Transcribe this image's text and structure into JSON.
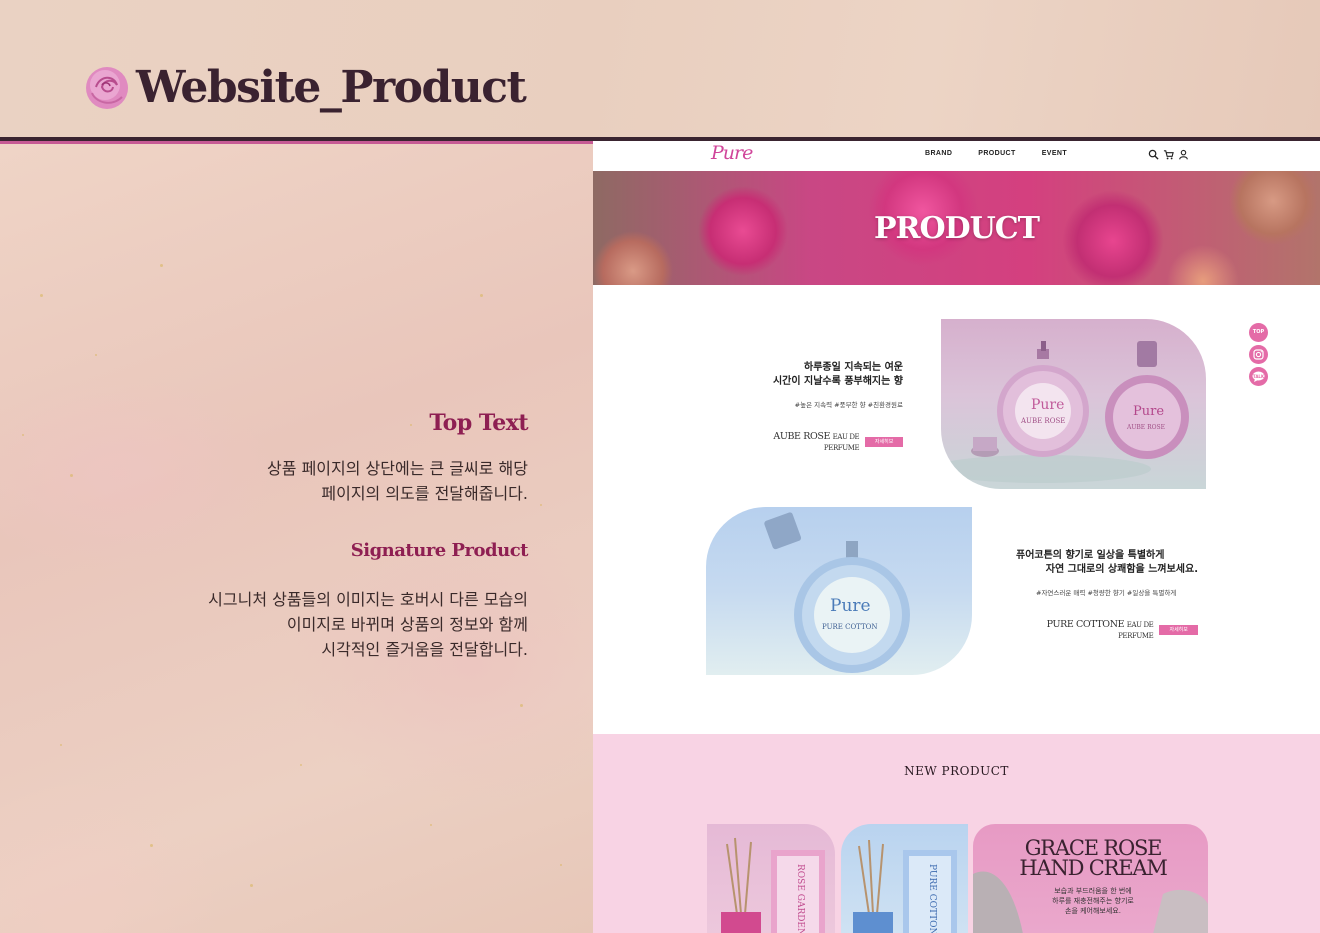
{
  "presentation": {
    "heading": "Website_Product",
    "sections": [
      {
        "title": "Top Text",
        "lines": [
          "상품 페이지의 상단에는 큰 글씨로 해당",
          "페이지의 의도를 전달해줍니다."
        ]
      },
      {
        "title": "Signature Product",
        "lines": [
          "시그니처 상품들의 이미지는 호버시 다른 모습의",
          "이미지로 바뀌며 상품의 정보와 함께",
          "시각적인 즐거움을 전달합니다."
        ]
      }
    ]
  },
  "site": {
    "logo": "Pure",
    "nav": [
      "BRAND",
      "PRODUCT",
      "EVENT"
    ],
    "nav_icons": [
      "search-icon",
      "cart-icon",
      "user-icon"
    ],
    "hero_title": "PRODUCT",
    "side_buttons": [
      "TOP",
      "instagram-icon",
      "TALK"
    ],
    "signature": [
      {
        "lines": [
          "하루종일 지속되는 여운",
          "시간이 지날수록 풍부해지는 향"
        ],
        "tags": "#높은 지속력 #풍부한 향 #친환경원료",
        "name_main": "AUBE ROSE",
        "name_sub": "EAU DE PERFUME",
        "button": "자세히보기",
        "label_main": "AUBE ROSE",
        "label_sub": "EAU DE PARFUM"
      },
      {
        "lines": [
          "퓨어코튼의 향기로 일상을 특별하게",
          "자연 그대로의 상쾌함을 느껴보세요."
        ],
        "tags": "#자연스러운 매력 #청량한 향기 #일상을 특별하게",
        "name_main": "PURE COTTONE",
        "name_sub": "EAU DE PERFUME",
        "button": "자세히보기",
        "label_main": "PURE COTTON"
      }
    ],
    "new_product": {
      "title": "NEW PRODUCT",
      "cards": [
        {
          "box_text": "ROSE GARDEN"
        },
        {
          "box_text": "PURE COTTON"
        },
        {
          "title_lines": [
            "GRACE ROSE",
            "HAND CREAM"
          ],
          "body_lines": [
            "보습과 부드러움을 한 번에",
            "하루를 재충전해주는 향기로",
            "손을 케어해보세요."
          ]
        }
      ]
    }
  },
  "colors": {
    "accent_pink": "#e46ba7",
    "heading_dark": "#3a2230",
    "title_magenta": "#8e1f52",
    "new_section_bg": "#f8d3e4"
  }
}
